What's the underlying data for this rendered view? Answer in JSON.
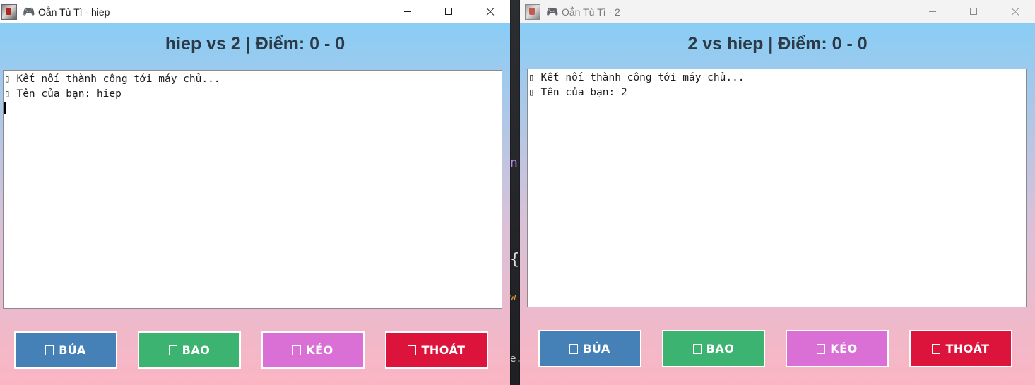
{
  "colors": {
    "rock": "#4580b6",
    "paper": "#3cb371",
    "scissors": "#da70d6",
    "quit": "#dc143c"
  },
  "windows": [
    {
      "title": "Oẳn Tù Tì - hiep",
      "pad_icon": "🎮",
      "header": "hiep vs 2 | Điểm: 0 - 0",
      "log_lines": [
        "▯ Kết nối thành công tới máy chủ...",
        "▯ Tên của bạn: hiep"
      ],
      "buttons": {
        "rock": "BÚA",
        "paper": "BAO",
        "scissors": "KÉO",
        "quit": "THOÁT"
      }
    },
    {
      "title": "Oẳn Tù Tì - 2",
      "pad_icon": "🎮",
      "header": "2 vs hiep | Điểm: 0 - 0",
      "log_lines": [
        "▯ Kết nối thành công tới máy chủ...",
        "▯ Tên của bạn: 2"
      ],
      "buttons": {
        "rock": "BÚA",
        "paper": "BAO",
        "scissors": "KÉO",
        "quit": "THOÁT"
      }
    }
  ],
  "background": {
    "glyph_brace": "{",
    "glyph_n": "n",
    "glyph_w": "w",
    "glyph_ef": "e.f"
  }
}
